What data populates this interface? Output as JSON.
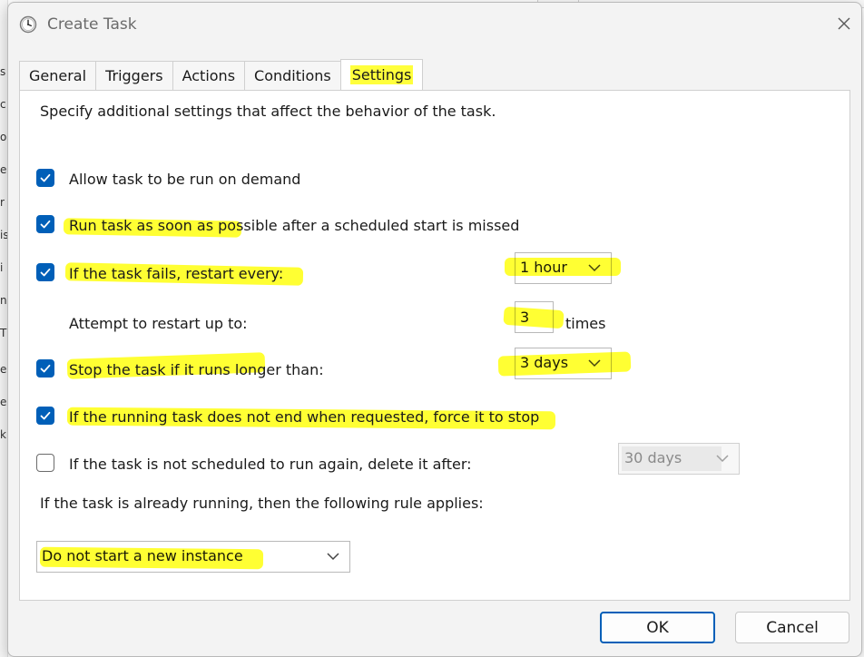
{
  "window": {
    "title": "Create Task",
    "icon": "clock-icon"
  },
  "tabs": [
    {
      "label": "General",
      "active": false
    },
    {
      "label": "Triggers",
      "active": false
    },
    {
      "label": "Actions",
      "active": false
    },
    {
      "label": "Conditions",
      "active": false
    },
    {
      "label": "Settings",
      "active": true
    }
  ],
  "settings": {
    "intro": "Specify additional settings that affect the behavior of the task.",
    "allow_on_demand": {
      "label": "Allow task to be run on demand",
      "checked": true
    },
    "run_missed": {
      "label": "Run task as soon as possible after a scheduled start is missed",
      "checked": true
    },
    "restart_on_fail": {
      "label": "If the task fails, restart every:",
      "checked": true,
      "interval": "1 hour"
    },
    "restart_attempts": {
      "label": "Attempt to restart up to:",
      "value": "3",
      "suffix": "times"
    },
    "stop_long": {
      "label": "Stop the task if it runs longer than:",
      "checked": true,
      "duration": "3 days"
    },
    "force_stop": {
      "label": "If the running task does not end when requested, force it to stop",
      "checked": true
    },
    "delete_after": {
      "label": "If the task is not scheduled to run again, delete it after:",
      "checked": false,
      "duration": "30 days"
    },
    "rule_label": "If the task is already running, then the following rule applies:",
    "rule_value": "Do not start a new instance"
  },
  "buttons": {
    "ok": "OK",
    "cancel": "Cancel"
  },
  "background": {
    "left_letters": [
      "s",
      "c",
      "o",
      "e",
      "r",
      "is",
      "i",
      "n",
      "T",
      "e",
      "e",
      "k"
    ]
  },
  "colors": {
    "accent": "#005fb8",
    "highlight": "#ffff00"
  }
}
